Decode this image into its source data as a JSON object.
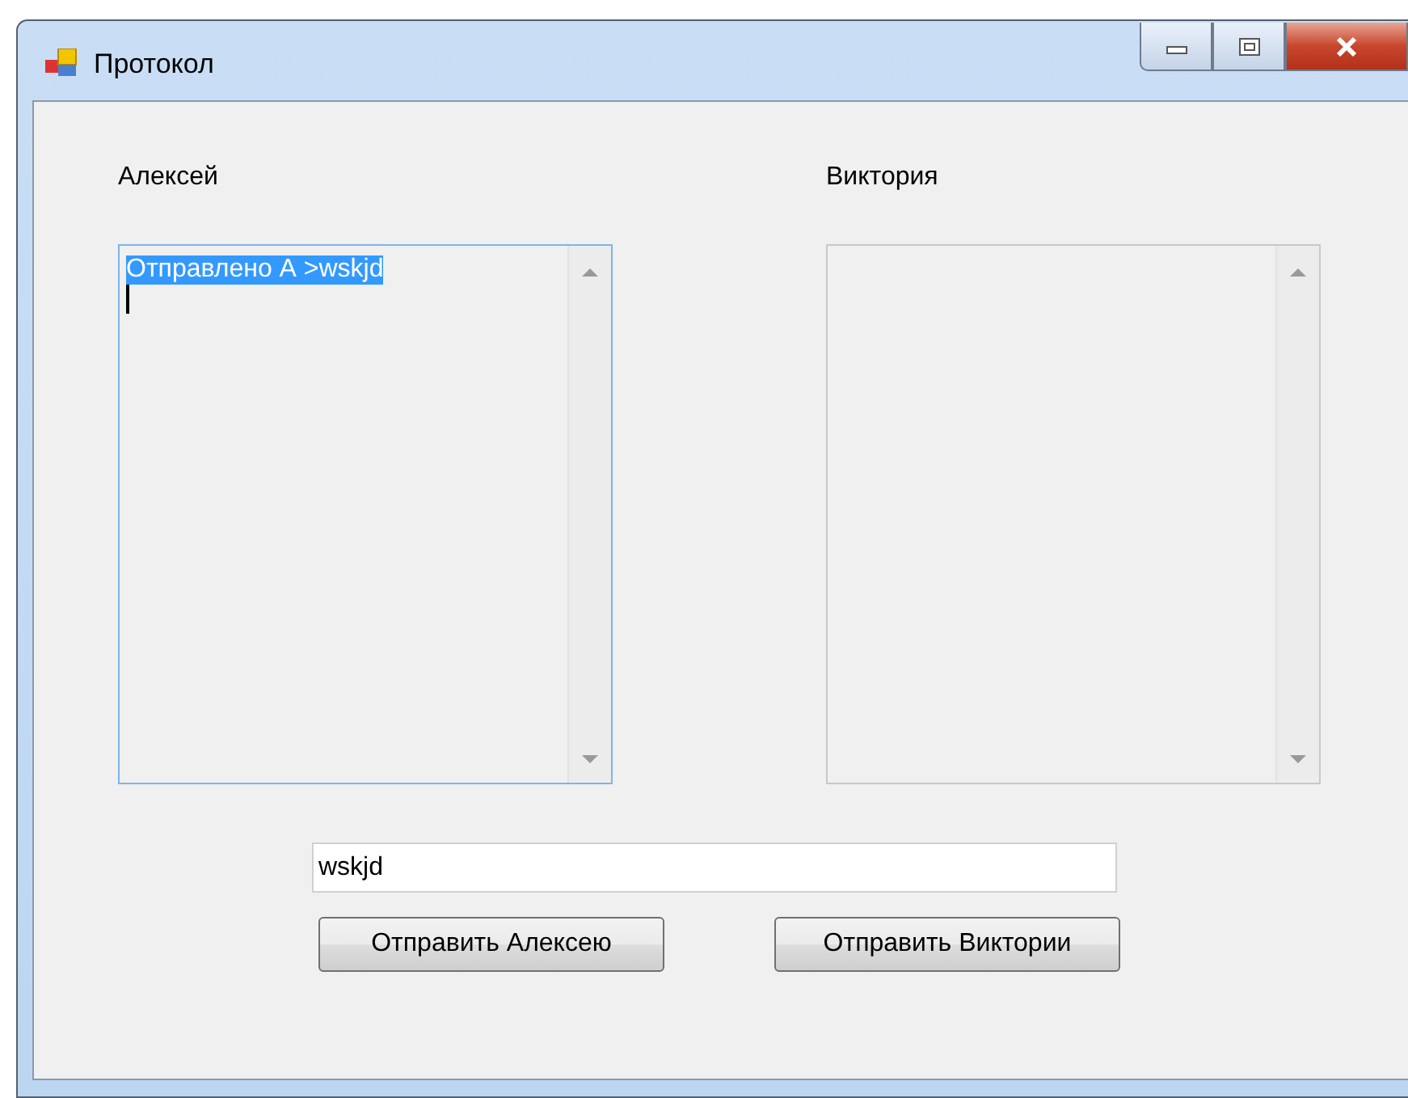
{
  "window": {
    "title": "Протокол"
  },
  "panels": [
    {
      "label": "Алексей",
      "focused": true,
      "messages": [
        {
          "text": "Отправлено А >wskjd",
          "selected": true
        }
      ]
    },
    {
      "label": "Виктория",
      "focused": false
    }
  ],
  "input": {
    "value": "wskjd"
  },
  "buttons": [
    "Отправить Алексею",
    "Отправить Виктории"
  ]
}
